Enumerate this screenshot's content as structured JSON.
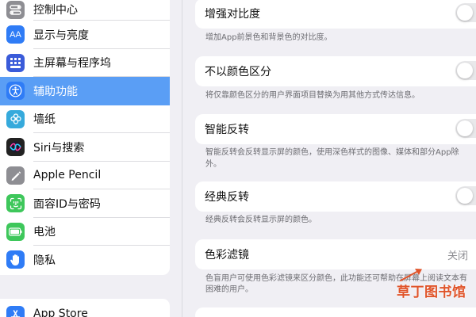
{
  "sidebar": {
    "items": [
      {
        "label": "控制中心",
        "icon": "control-center-icon",
        "color": "#8e8e93"
      },
      {
        "label": "显示与亮度",
        "icon": "display-brightness-icon",
        "color": "#2f7cf6"
      },
      {
        "label": "主屏幕与程序坞",
        "icon": "home-screen-dock-icon",
        "color": "#3a5bd9"
      },
      {
        "label": "辅助功能",
        "icon": "accessibility-icon",
        "color": "#2f7cf6"
      },
      {
        "label": "墙纸",
        "icon": "wallpaper-icon",
        "color": "#36aadc"
      },
      {
        "label": "Siri与搜索",
        "icon": "siri-icon",
        "color": "#222222"
      },
      {
        "label": "Apple Pencil",
        "icon": "pencil-icon",
        "color": "#8e8e93"
      },
      {
        "label": "面容ID与密码",
        "icon": "face-id-icon",
        "color": "#3ec75b"
      },
      {
        "label": "电池",
        "icon": "battery-icon",
        "color": "#3ec75b"
      },
      {
        "label": "隐私",
        "icon": "privacy-hand-icon",
        "color": "#2f7cf6"
      }
    ],
    "selected_index": 3,
    "bottom_item": {
      "label": "App Store",
      "icon": "app-store-icon",
      "color": "#2f7cf6"
    }
  },
  "main": {
    "settings": [
      {
        "label": "增强对比度",
        "description": "增加App前景色和背景色的对比度。",
        "control": "toggle",
        "on": false
      },
      {
        "label": "不以颜色区分",
        "description": "将仅靠颜色区分的用户界面项目替换为用其他方式传达信息。",
        "control": "toggle",
        "on": false
      },
      {
        "label": "智能反转",
        "description": "智能反转会反转显示屏的颜色，使用深色样式的图像、媒体和部分App除外。",
        "control": "toggle",
        "on": false
      },
      {
        "label": "经典反转",
        "description": "经典反转会反转显示屏的颜色。",
        "control": "toggle",
        "on": false
      },
      {
        "label": "色彩滤镜",
        "value": "关闭",
        "description_line1": "色盲用户可使用色彩滤镜来区分颜色，此功能还可帮助在屏幕上阅读文本有",
        "description_line2": "困难的用户。",
        "control": "disclosure"
      }
    ]
  },
  "watermark": {
    "text": "草丁图书馆",
    "color": "#e0542a"
  }
}
